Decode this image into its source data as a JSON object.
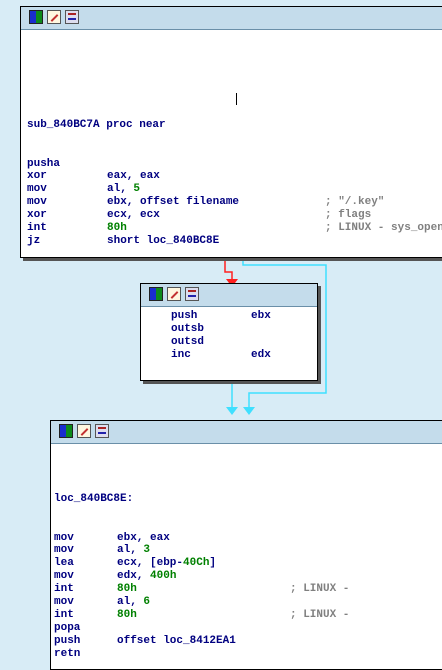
{
  "colors": {
    "background": "#d8ecf6",
    "mnemonic": "#000080",
    "number": "#008000",
    "comment": "#808080",
    "edge_false": "#ff2020",
    "edge_true": "#3fe0ff"
  },
  "toolbar_icons": [
    "graph-overview-icon",
    "edit-node-icon",
    "view-node-icon"
  ],
  "block1": {
    "header": "sub_840BC7A proc near",
    "lines": [
      {
        "mn": "pusha",
        "op": "",
        "cm": ""
      },
      {
        "mn": "xor",
        "op": "eax, eax",
        "cm": ""
      },
      {
        "mn": "mov",
        "op": "al, 5",
        "cm": ""
      },
      {
        "mn": "mov",
        "op": "ebx, offset filename",
        "cm": "; \"/.key\""
      },
      {
        "mn": "xor",
        "op": "ecx, ecx",
        "cm": "; flags"
      },
      {
        "mn": "int",
        "op": "80h",
        "cm": "; LINUX - sys_open"
      },
      {
        "mn": "jz",
        "op": "short loc_840BC8E",
        "cm": ""
      }
    ]
  },
  "block2": {
    "lines": [
      {
        "mn": "push",
        "op": "ebx"
      },
      {
        "mn": "outsb",
        "op": ""
      },
      {
        "mn": "outsd",
        "op": ""
      },
      {
        "mn": "inc",
        "op": "edx"
      }
    ]
  },
  "block3": {
    "header": "loc_840BC8E:",
    "lines": [
      {
        "mn": "mov",
        "op": "ebx, eax",
        "cm": ""
      },
      {
        "mn": "mov",
        "op": "al, 3",
        "cm": ""
      },
      {
        "mn": "lea",
        "op": "ecx, [ebp-40Ch]",
        "cm": ""
      },
      {
        "mn": "mov",
        "op": "edx, 400h",
        "cm": ""
      },
      {
        "mn": "int",
        "op": "80h",
        "cm": "; LINUX -"
      },
      {
        "mn": "mov",
        "op": "al, 6",
        "cm": ""
      },
      {
        "mn": "int",
        "op": "80h",
        "cm": "; LINUX -"
      },
      {
        "mn": "popa",
        "op": "",
        "cm": ""
      },
      {
        "mn": "push",
        "op": "offset loc_8412EA1",
        "cm": ""
      },
      {
        "mn": "retn",
        "op": "",
        "cm": ""
      }
    ]
  }
}
